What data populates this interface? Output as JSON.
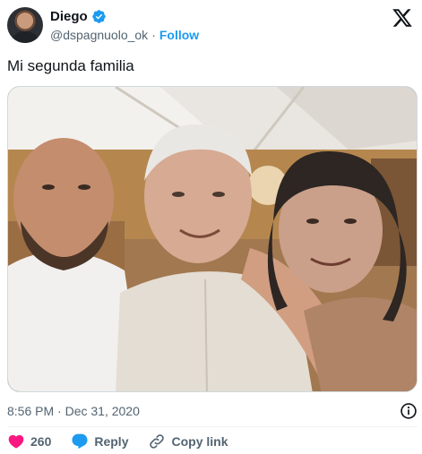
{
  "author": {
    "display_name": "Diego",
    "handle": "@dspagnuolo_ok",
    "separator": "·",
    "follow_label": "Follow",
    "verified_color": "#1d9bf0"
  },
  "tweet": {
    "text": "Mi segunda familia",
    "timestamp": "8:56 PM · Dec 31, 2020"
  },
  "actions": {
    "like_count": "260",
    "reply_label": "Reply",
    "copy_link_label": "Copy link"
  },
  "icons": {
    "platform_logo": "x-logo-icon",
    "verified": "verified-badge-icon",
    "info": "info-icon",
    "like": "heart-icon",
    "reply": "reply-bubble-icon",
    "copy_link": "link-icon"
  },
  "colors": {
    "accent": "#1d9bf0",
    "like": "#f91880",
    "text_primary": "#0f1419",
    "text_secondary": "#536471"
  }
}
